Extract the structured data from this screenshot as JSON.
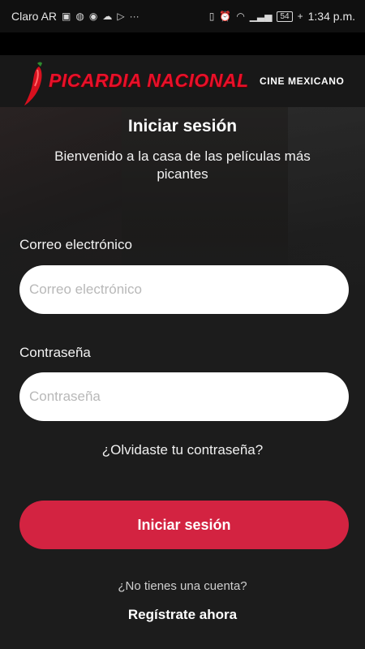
{
  "status_bar": {
    "carrier": "Claro AR",
    "battery": "54",
    "time": "1:34 p.m.",
    "more": "···"
  },
  "header": {
    "brand": "PICARDIA NACIONAL",
    "subtitle": "CINE MEXICANO",
    "colors": {
      "brand_red": "#e8102a",
      "button_red": "#d32341",
      "background": "#1c1c1c"
    }
  },
  "login": {
    "title": "Iniciar sesión",
    "welcome": "Bienvenido a la casa de las películas más picantes",
    "email_label": "Correo electrónico",
    "email_placeholder": "Correo electrónico",
    "password_label": "Contraseña",
    "password_placeholder": "Contraseña",
    "forgot": "¿Olvidaste tu contraseña?",
    "submit": "Iniciar sesión",
    "no_account": "¿No tienes una cuenta?",
    "register": "Regístrate ahora"
  }
}
